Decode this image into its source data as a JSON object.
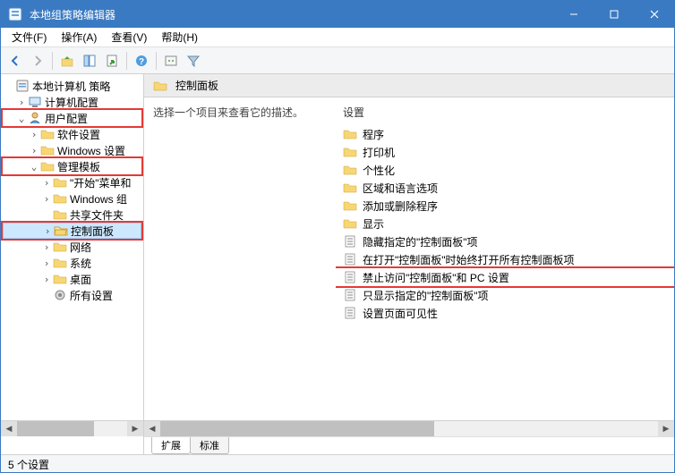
{
  "title": "本地组策略编辑器",
  "menus": {
    "file": "文件(F)",
    "action": "操作(A)",
    "view": "查看(V)",
    "help": "帮助(H)"
  },
  "tree": {
    "root": "本地计算机 策略",
    "comp_cfg": "计算机配置",
    "user_cfg": "用户配置",
    "sw": "软件设置",
    "win": "Windows 设置",
    "admin": "管理模板",
    "start": "\"开始\"菜单和",
    "wincomp": "Windows 组",
    "shared": "共享文件夹",
    "ctrlpanel": "控制面板",
    "network": "网络",
    "system": "系统",
    "desktop": "桌面",
    "allset": "所有设置"
  },
  "detail": {
    "header": "控制面板",
    "descr": "选择一个项目来查看它的描述。",
    "col_settings": "设置",
    "items": {
      "prog": "程序",
      "printer": "打印机",
      "personal": "个性化",
      "region": "区域和语言选项",
      "addremove": "添加或删除程序",
      "display": "显示",
      "hide": "隐藏指定的\"控制面板\"项",
      "open": "在打开\"控制面板\"时始终打开所有控制面板项",
      "deny": "禁止访问\"控制面板\"和 PC 设置",
      "showonly": "只显示指定的\"控制面板\"项",
      "pagevis": "设置页面可见性"
    }
  },
  "tabs": {
    "ext": "扩展",
    "std": "标准"
  },
  "status": "5 个设置"
}
